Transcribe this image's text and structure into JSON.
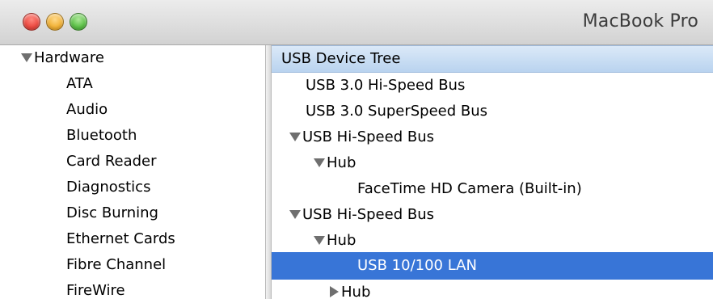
{
  "window": {
    "title": "MacBook Pro"
  },
  "sidebar": {
    "section": {
      "label": "Hardware",
      "expanded": true
    },
    "items": [
      {
        "label": "ATA"
      },
      {
        "label": "Audio"
      },
      {
        "label": "Bluetooth"
      },
      {
        "label": "Card Reader"
      },
      {
        "label": "Diagnostics"
      },
      {
        "label": "Disc Burning"
      },
      {
        "label": "Ethernet Cards"
      },
      {
        "label": "Fibre Channel"
      },
      {
        "label": "FireWire"
      }
    ]
  },
  "main": {
    "header": "USB Device Tree",
    "tree": [
      {
        "label": "USB 3.0 Hi-Speed Bus",
        "disclosure": "none"
      },
      {
        "label": "USB 3.0 SuperSpeed Bus",
        "disclosure": "none"
      },
      {
        "label": "USB Hi-Speed Bus",
        "disclosure": "expanded"
      },
      {
        "label": "Hub",
        "disclosure": "expanded"
      },
      {
        "label": "FaceTime HD Camera (Built-in)",
        "disclosure": "none"
      },
      {
        "label": "USB Hi-Speed Bus",
        "disclosure": "expanded"
      },
      {
        "label": "Hub",
        "disclosure": "expanded"
      },
      {
        "label": "USB 10/100 LAN",
        "disclosure": "none",
        "selected": true
      },
      {
        "label": "Hub",
        "disclosure": "collapsed"
      }
    ]
  },
  "colors": {
    "selection": "#3875d7",
    "header_bg": "#c8ddf4",
    "close": "#ec4c43",
    "minimize": "#f2b33a",
    "zoom": "#5fc24a"
  }
}
